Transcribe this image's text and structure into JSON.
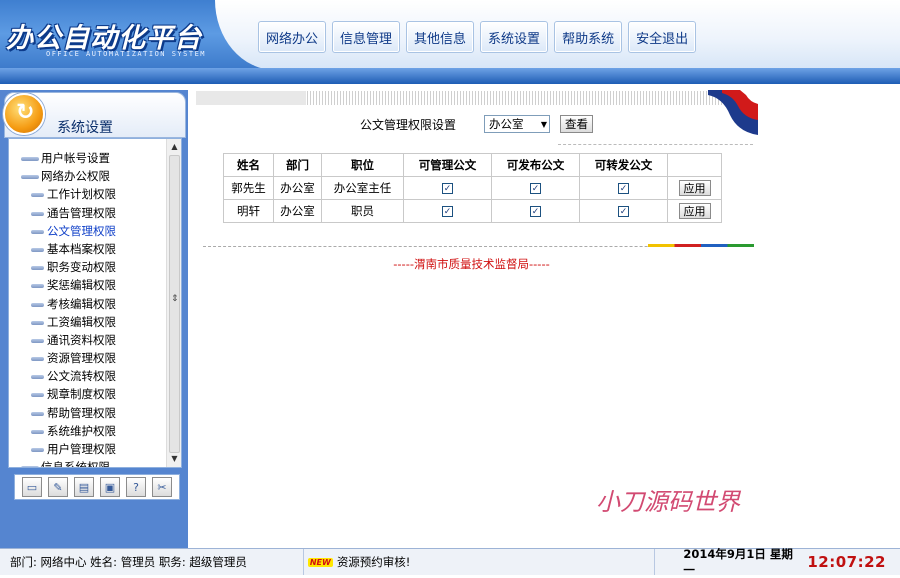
{
  "app": {
    "title": "办公自动化平台",
    "subtitle": "OFFICE AUTOMATIZATION SYSTEM"
  },
  "nav": {
    "items": [
      "网络办公",
      "信息管理",
      "其他信息",
      "系统设置",
      "帮助系统",
      "安全退出"
    ]
  },
  "sidebar": {
    "title": "系统设置",
    "items": [
      {
        "label": "用户帐号设置",
        "level": 0
      },
      {
        "label": "网络办公权限",
        "level": 0
      },
      {
        "label": "工作计划权限",
        "level": 1
      },
      {
        "label": "通告管理权限",
        "level": 1
      },
      {
        "label": "公文管理权限",
        "level": 1,
        "selected": true
      },
      {
        "label": "基本档案权限",
        "level": 1
      },
      {
        "label": "职务变动权限",
        "level": 1
      },
      {
        "label": "奖惩编辑权限",
        "level": 1
      },
      {
        "label": "考核编辑权限",
        "level": 1
      },
      {
        "label": "工资编辑权限",
        "level": 1
      },
      {
        "label": "通讯资料权限",
        "level": 1
      },
      {
        "label": "资源管理权限",
        "level": 1
      },
      {
        "label": "公文流转权限",
        "level": 1
      },
      {
        "label": "规章制度权限",
        "level": 1
      },
      {
        "label": "帮助管理权限",
        "level": 1
      },
      {
        "label": "系统维护权限",
        "level": 1
      },
      {
        "label": "用户管理权限",
        "level": 1
      },
      {
        "label": "信息系统权限",
        "level": 0
      }
    ],
    "tool_icons": [
      "window-icon",
      "edit-icon",
      "document-icon",
      "computer-icon",
      "help-icon",
      "tools-icon"
    ]
  },
  "filter": {
    "label": "公文管理权限设置",
    "department": "办公室",
    "view_button": "查看"
  },
  "table": {
    "headers": [
      "姓名",
      "部门",
      "职位",
      "可管理公文",
      "可发布公文",
      "可转发公文",
      ""
    ],
    "rows": [
      {
        "name": "郭先生",
        "dept": "办公室",
        "position": "办公室主任",
        "manage": true,
        "publish": true,
        "forward": true,
        "action": "应用"
      },
      {
        "name": "明轩",
        "dept": "办公室",
        "position": "职员",
        "manage": true,
        "publish": true,
        "forward": true,
        "action": "应用"
      }
    ]
  },
  "footer": {
    "org": "-----渭南市质量技术监督局-----",
    "watermark": "小刀源码世界"
  },
  "status": {
    "user_info": "部门: 网络中心  姓名: 管理员  职务: 超级管理员",
    "new_badge": "NEW",
    "message": "资源预约审核!",
    "date": "2014年9月1日  星期一",
    "time": "12:07:22"
  }
}
